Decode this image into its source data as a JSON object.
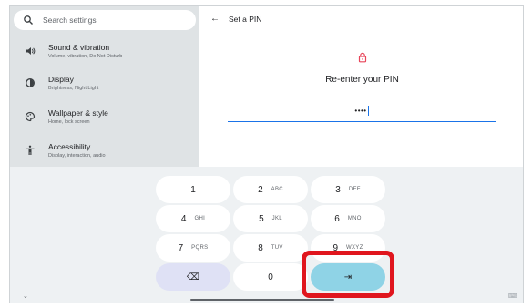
{
  "search": {
    "placeholder": "Search settings",
    "icon": "search-icon"
  },
  "settings_items": [
    {
      "title": "Sound & vibration",
      "subtitle": "Volume, vibration, Do Not Disturb",
      "icon": "volume-icon"
    },
    {
      "title": "Display",
      "subtitle": "Brightness, Night Light",
      "icon": "brightness-icon"
    },
    {
      "title": "Wallpaper & style",
      "subtitle": "Home, lock screen",
      "icon": "palette-icon"
    },
    {
      "title": "Accessibility",
      "subtitle": "Display, interaction, audio",
      "icon": "accessibility-icon"
    }
  ],
  "pin_screen": {
    "back_glyph": "←",
    "title": "Set a PIN",
    "prompt": "Re-enter your PIN",
    "entered_mask": "••••",
    "accent_color": "#e8455a"
  },
  "keypad": {
    "keys": [
      {
        "num": "1",
        "letters": ""
      },
      {
        "num": "2",
        "letters": "ABC"
      },
      {
        "num": "3",
        "letters": "DEF"
      },
      {
        "num": "4",
        "letters": "GHI"
      },
      {
        "num": "5",
        "letters": "JKL"
      },
      {
        "num": "6",
        "letters": "MNO"
      },
      {
        "num": "7",
        "letters": "PQRS"
      },
      {
        "num": "8",
        "letters": "TUV"
      },
      {
        "num": "9",
        "letters": "WXYZ"
      }
    ],
    "zero": "0",
    "delete_glyph": "⌫",
    "enter_glyph": "⇥",
    "hide_glyph": "⌄",
    "switch_glyph": "⌨",
    "enter_color": "#8fd3e6",
    "highlight_color": "#e0161e"
  }
}
